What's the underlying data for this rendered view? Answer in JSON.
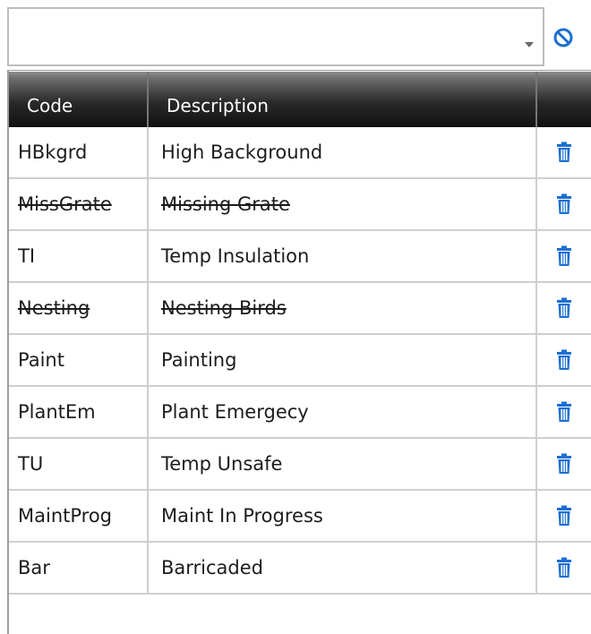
{
  "filter": {
    "value": "",
    "clear_icon": "no-entry-icon",
    "dropdown_icon": "chevron-down-icon"
  },
  "grid": {
    "columns": [
      "Code",
      "Description",
      ""
    ],
    "rows": [
      {
        "code": "HBkgrd",
        "description": "High Background",
        "deleted": false
      },
      {
        "code": "MissGrate",
        "description": "Missing Grate",
        "deleted": true
      },
      {
        "code": "TI",
        "description": "Temp Insulation",
        "deleted": false
      },
      {
        "code": "Nesting",
        "description": "Nesting Birds",
        "deleted": true
      },
      {
        "code": "Paint",
        "description": "Painting",
        "deleted": false
      },
      {
        "code": "PlantEm",
        "description": "Plant Emergecy",
        "deleted": false
      },
      {
        "code": "TU",
        "description": "Temp Unsafe",
        "deleted": false
      },
      {
        "code": "MaintProg",
        "description": "Maint In Progress",
        "deleted": false
      },
      {
        "code": "Bar",
        "description": "Barricaded",
        "deleted": false
      }
    ],
    "row_action_icon": "trash-icon"
  },
  "colors": {
    "header_bg": "#1a1a1a",
    "icon_blue": "#1b6fd1",
    "grid_line": "#cfcfcf"
  }
}
